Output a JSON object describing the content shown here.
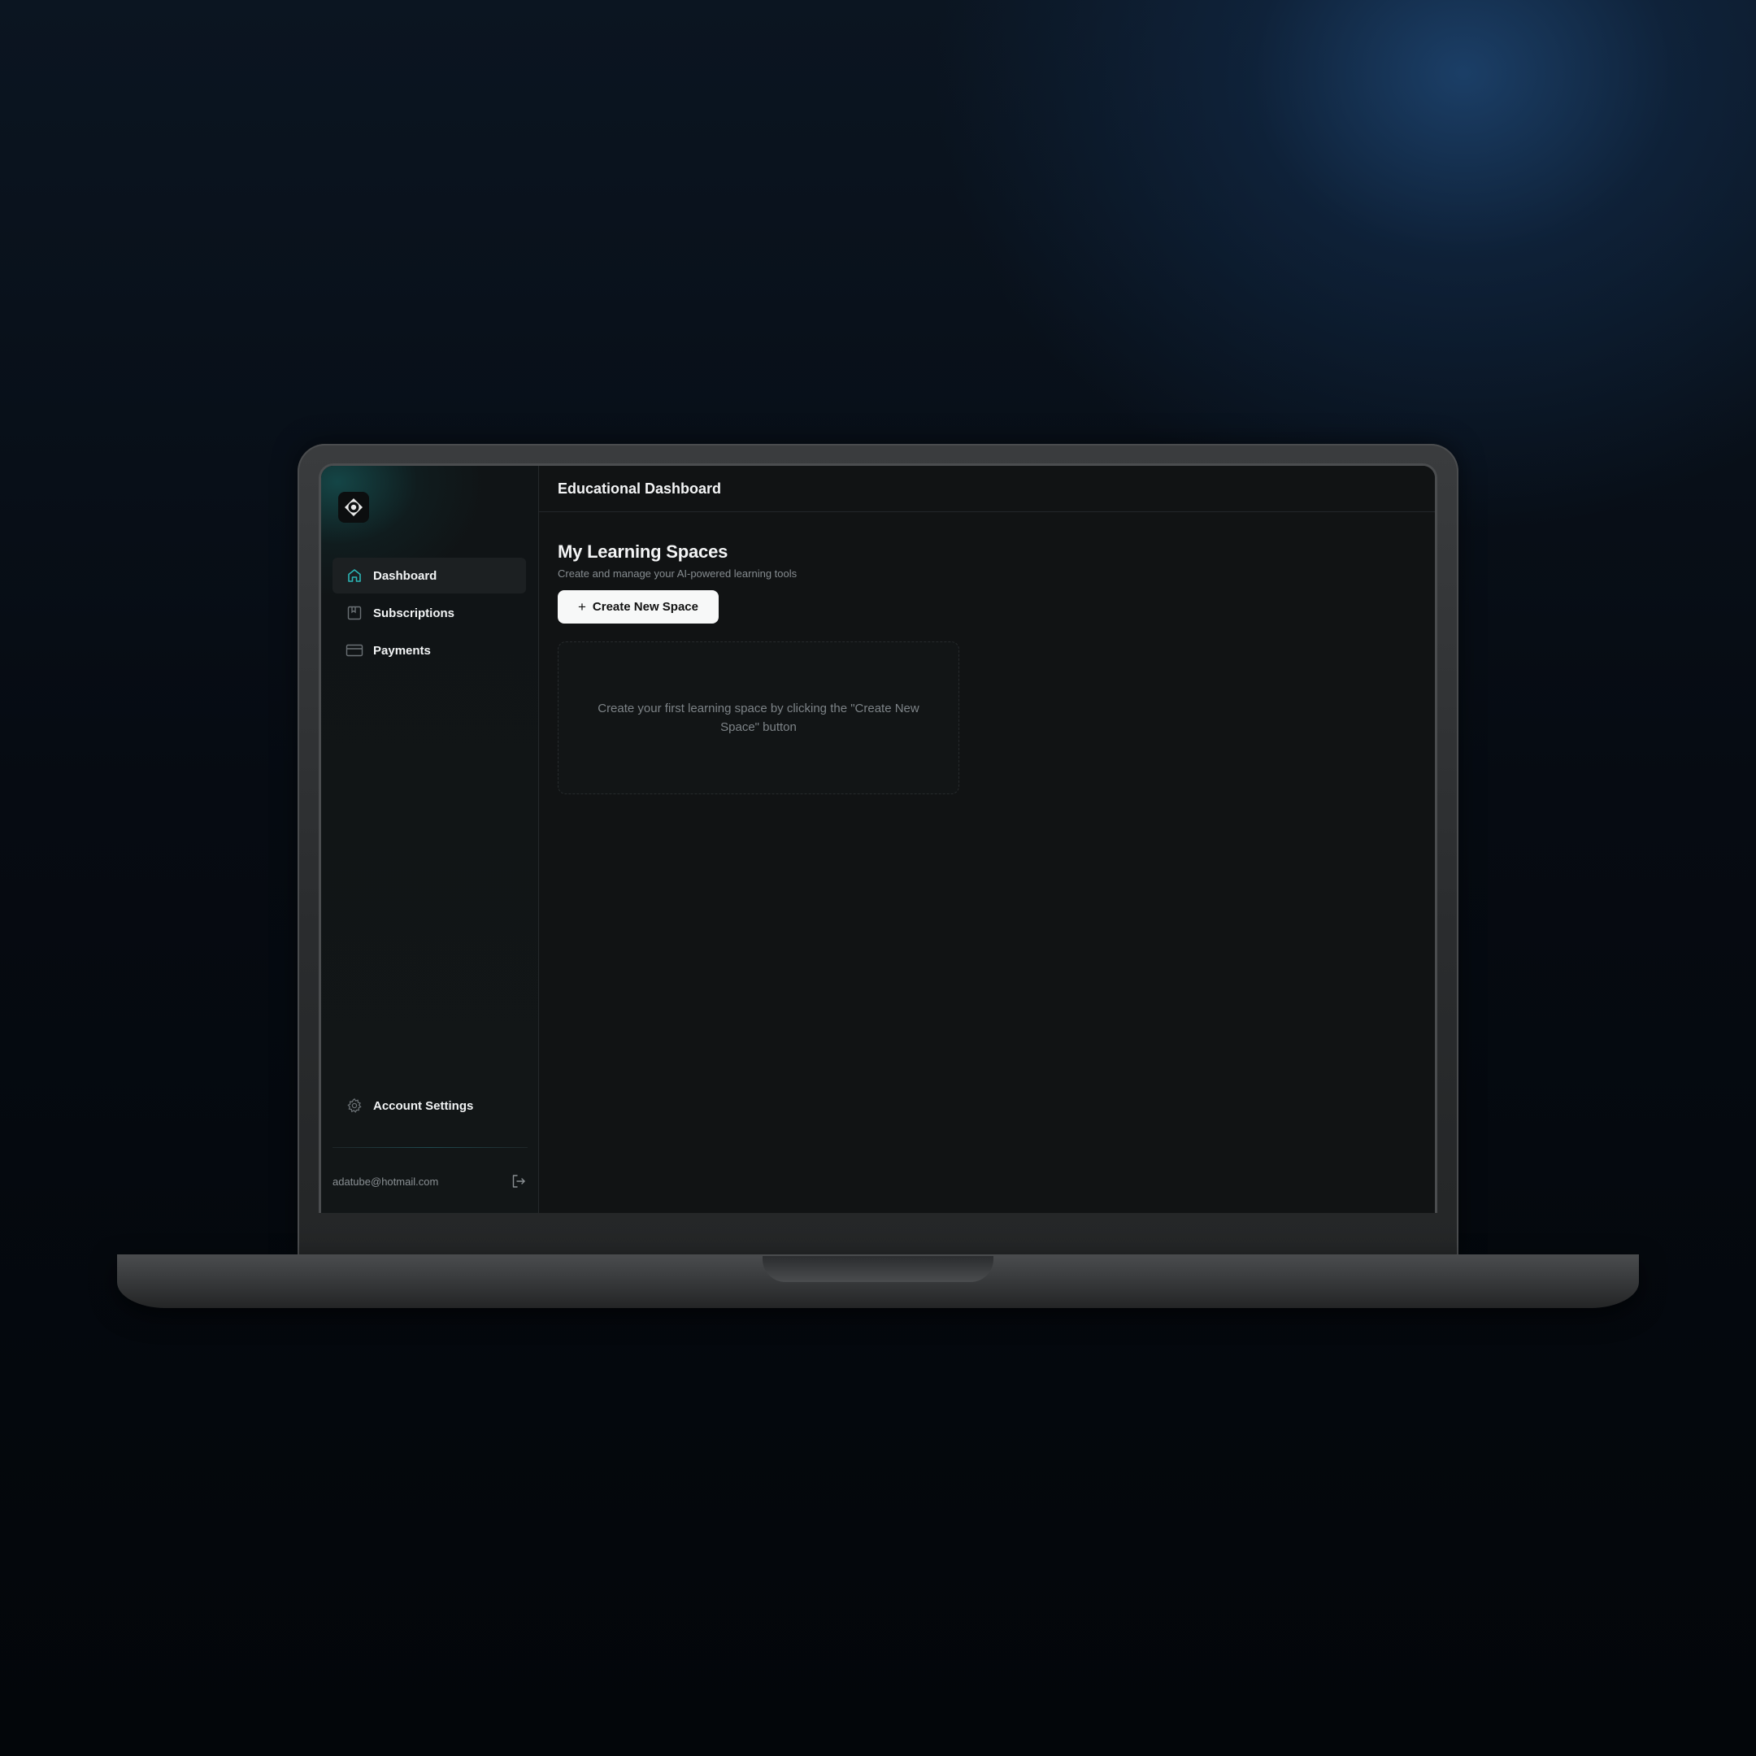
{
  "header": {
    "title": "Educational Dashboard"
  },
  "sidebar": {
    "logo_icon": "diamond-ring-logo-icon",
    "items": [
      {
        "label": "Dashboard",
        "icon": "home-icon",
        "active": true
      },
      {
        "label": "Subscriptions",
        "icon": "bookmark-icon",
        "active": false
      },
      {
        "label": "Payments",
        "icon": "credit-card-icon",
        "active": false
      }
    ],
    "settings": {
      "label": "Account Settings",
      "icon": "gear-icon"
    },
    "user": {
      "email": "adatube@hotmail.com",
      "logout_icon": "logout-icon"
    }
  },
  "main": {
    "title": "My Learning Spaces",
    "subtitle": "Create and manage your AI-powered learning tools",
    "create_button": {
      "label": "Create New Space",
      "icon": "plus-icon"
    },
    "empty_state": "Create your first learning space by clicking the \"Create New Space\" button"
  },
  "colors": {
    "accent": "#2bb5b5",
    "background": "#111314",
    "sidebar": "#121617",
    "button": "#f7f8f8"
  }
}
